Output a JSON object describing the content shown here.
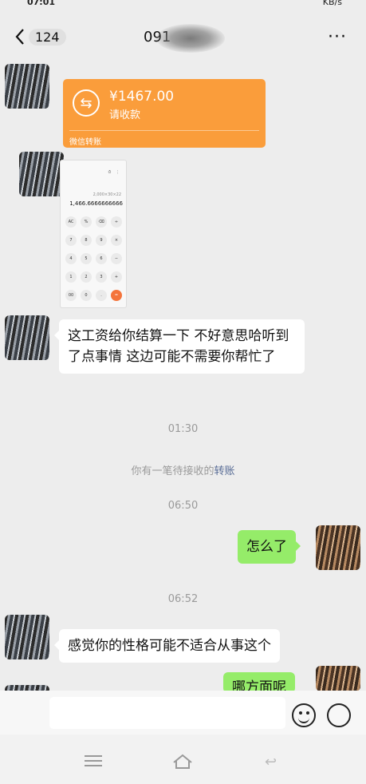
{
  "status_bar": {
    "time": "07:01",
    "right": "KB/s"
  },
  "header": {
    "back_count": "124",
    "title": "091",
    "more": "···"
  },
  "transfer": {
    "amount": "¥1467.00",
    "status": "请收款",
    "source": "微信转账",
    "color": "#fa9d3b"
  },
  "calculator": {
    "expression": "2,000×30×22",
    "result": "1,466.6666666666",
    "keys": [
      "AC",
      "%",
      "⌫",
      "÷",
      "7",
      "8",
      "9",
      "×",
      "4",
      "5",
      "6",
      "−",
      "1",
      "2",
      "3",
      "+",
      "00",
      "0",
      ".",
      "="
    ]
  },
  "messages": {
    "msg1": "这工资给你结算一下 不好意思哈听到了点事情 这边可能不需要你帮忙了",
    "time1": "01:30",
    "system": {
      "prefix": "你有一笔待接收的",
      "link": "转账"
    },
    "time2": "06:50",
    "msg2": "怎么了",
    "time3": "06:52",
    "msg3": "感觉你的性格可能不适合从事这个",
    "msg4": "哪方面呢"
  },
  "colors": {
    "out_bubble": "#95ec69",
    "in_bubble": "#ffffff",
    "link": "#576b95"
  }
}
